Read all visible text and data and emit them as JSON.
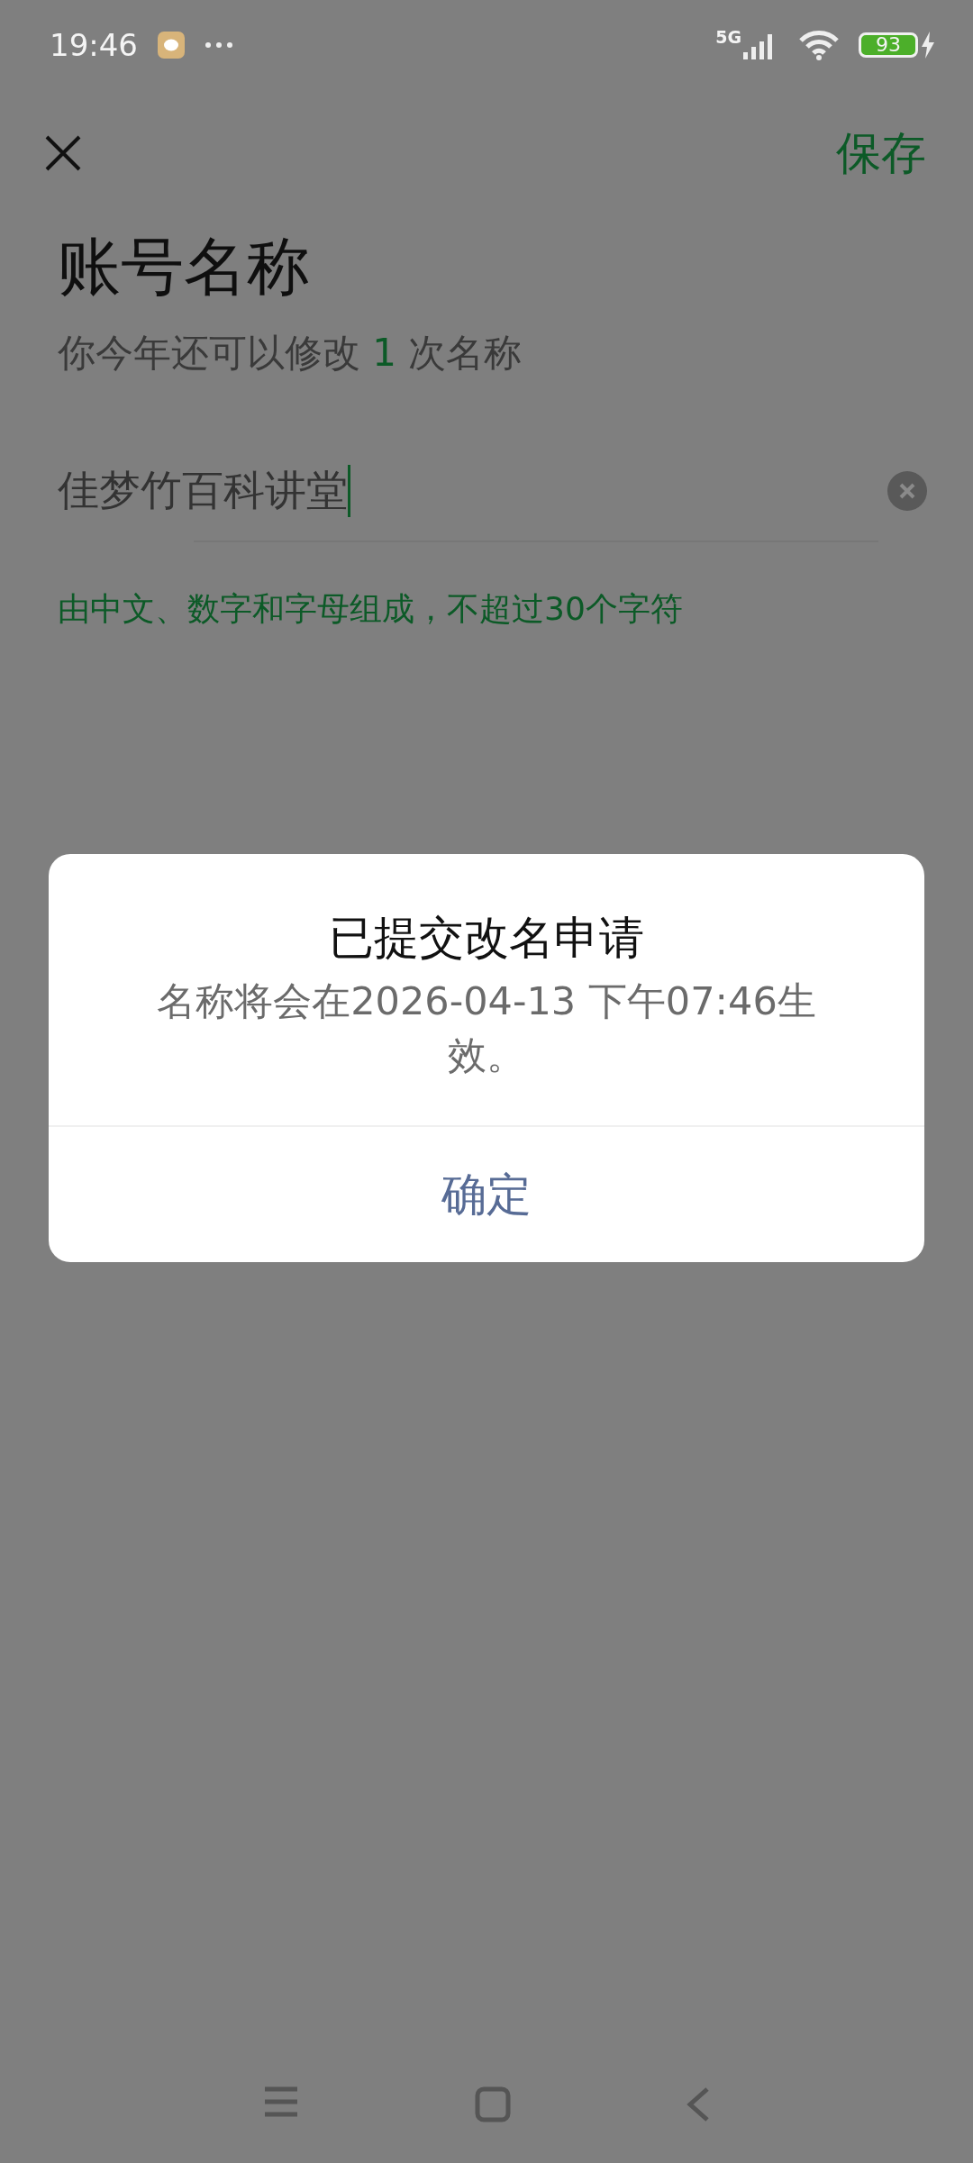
{
  "status_bar": {
    "time": "19:46",
    "network": "5G",
    "battery": "93"
  },
  "header": {
    "save": "保存"
  },
  "title": "账号名称",
  "subtitle": {
    "before": "你今年还可以修改 ",
    "count": "1",
    "after": " 次名称"
  },
  "name_field": {
    "value": "佳梦竹百科讲堂",
    "focused": true
  },
  "hint": "由中文、数字和字母组成，不超过30个字符",
  "dialog": {
    "title": "已提交改名申请",
    "message": "名称将会在2026-04-13 下午07:46生效。",
    "button": "确定"
  }
}
